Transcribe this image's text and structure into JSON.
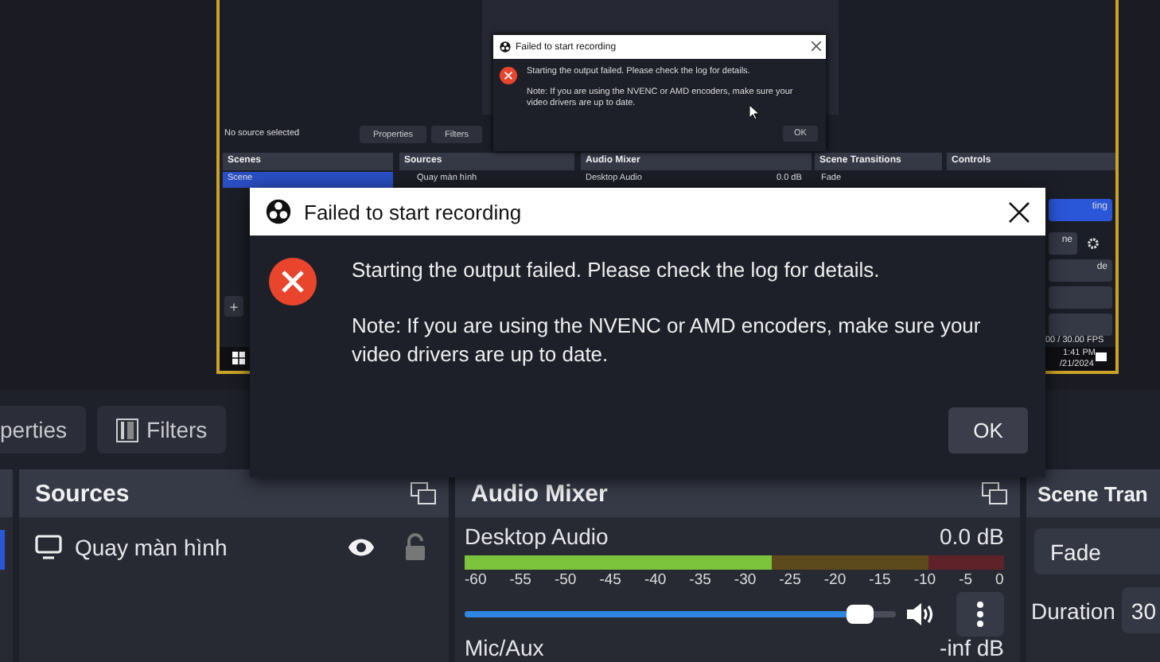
{
  "preview": {
    "nested_screen": {
      "status": "No source selected",
      "buttons": [
        "Properties",
        "Filters"
      ],
      "docks": [
        {
          "title": "Scenes"
        },
        {
          "title": "Sources"
        },
        {
          "title": "Audio Mixer"
        },
        {
          "title": "Scene Transitions"
        },
        {
          "title": "Controls"
        }
      ],
      "scene_item": {
        "label": "Scene",
        "selected": true
      },
      "source_item": "Quay màn hình",
      "audio_item": {
        "name": "Desktop Audio",
        "reading": "0.0 dB"
      },
      "transition": "Fade",
      "dialog": {
        "title": "Failed to start recording",
        "message": "Starting the output failed. Please check the log for details.",
        "note": "Note: If you are using the NVENC or AMD encoders, make sure your video drivers are up to date.",
        "button": "OK"
      },
      "add_button": "+",
      "control_buttons": [
        {
          "label": "ting",
          "selected": true
        },
        {
          "label": "ne",
          "selected": false
        },
        {
          "label": "de",
          "selected": false
        },
        {
          "selected": false
        },
        {
          "selected": false
        }
      ],
      "fps": "00 / 30.00 FPS",
      "clock": {
        "time": "1:41 PM",
        "date": "/21/2024"
      }
    }
  },
  "source_toolbar": {
    "buttons": [
      "perties",
      "Filters"
    ]
  },
  "scenes_dock": {
    "items": [
      {
        "selected": true
      }
    ]
  },
  "sources_dock": {
    "title": "Sources",
    "items": [
      {
        "name": "Quay màn hình",
        "visible": true,
        "locked": false
      }
    ]
  },
  "audio_mixer": {
    "title": "Audio Mixer",
    "channels": [
      {
        "name": "Desktop Audio",
        "reading": "0.0 dB",
        "meter": {
          "level": 0.57
        },
        "volume": {
          "level": 0.95
        },
        "ticks": [
          "-60",
          "-55",
          "-50",
          "-45",
          "-40",
          "-35",
          "-30",
          "-25",
          "-20",
          "-15",
          "-10",
          "-5",
          "0"
        ]
      },
      {
        "name": "Mic/Aux",
        "reading": "-inf dB"
      }
    ]
  },
  "scene_transitions": {
    "title": "Scene Tran",
    "transition": "Fade",
    "duration_label": "Duration",
    "duration": "30"
  },
  "dialog": {
    "title": "Failed to start recording",
    "message": "Starting the output failed. Please check the log for details.",
    "note": "Note: If you are using the NVENC or AMD encoders, make sure your video drivers are up to date.",
    "button": "OK"
  }
}
